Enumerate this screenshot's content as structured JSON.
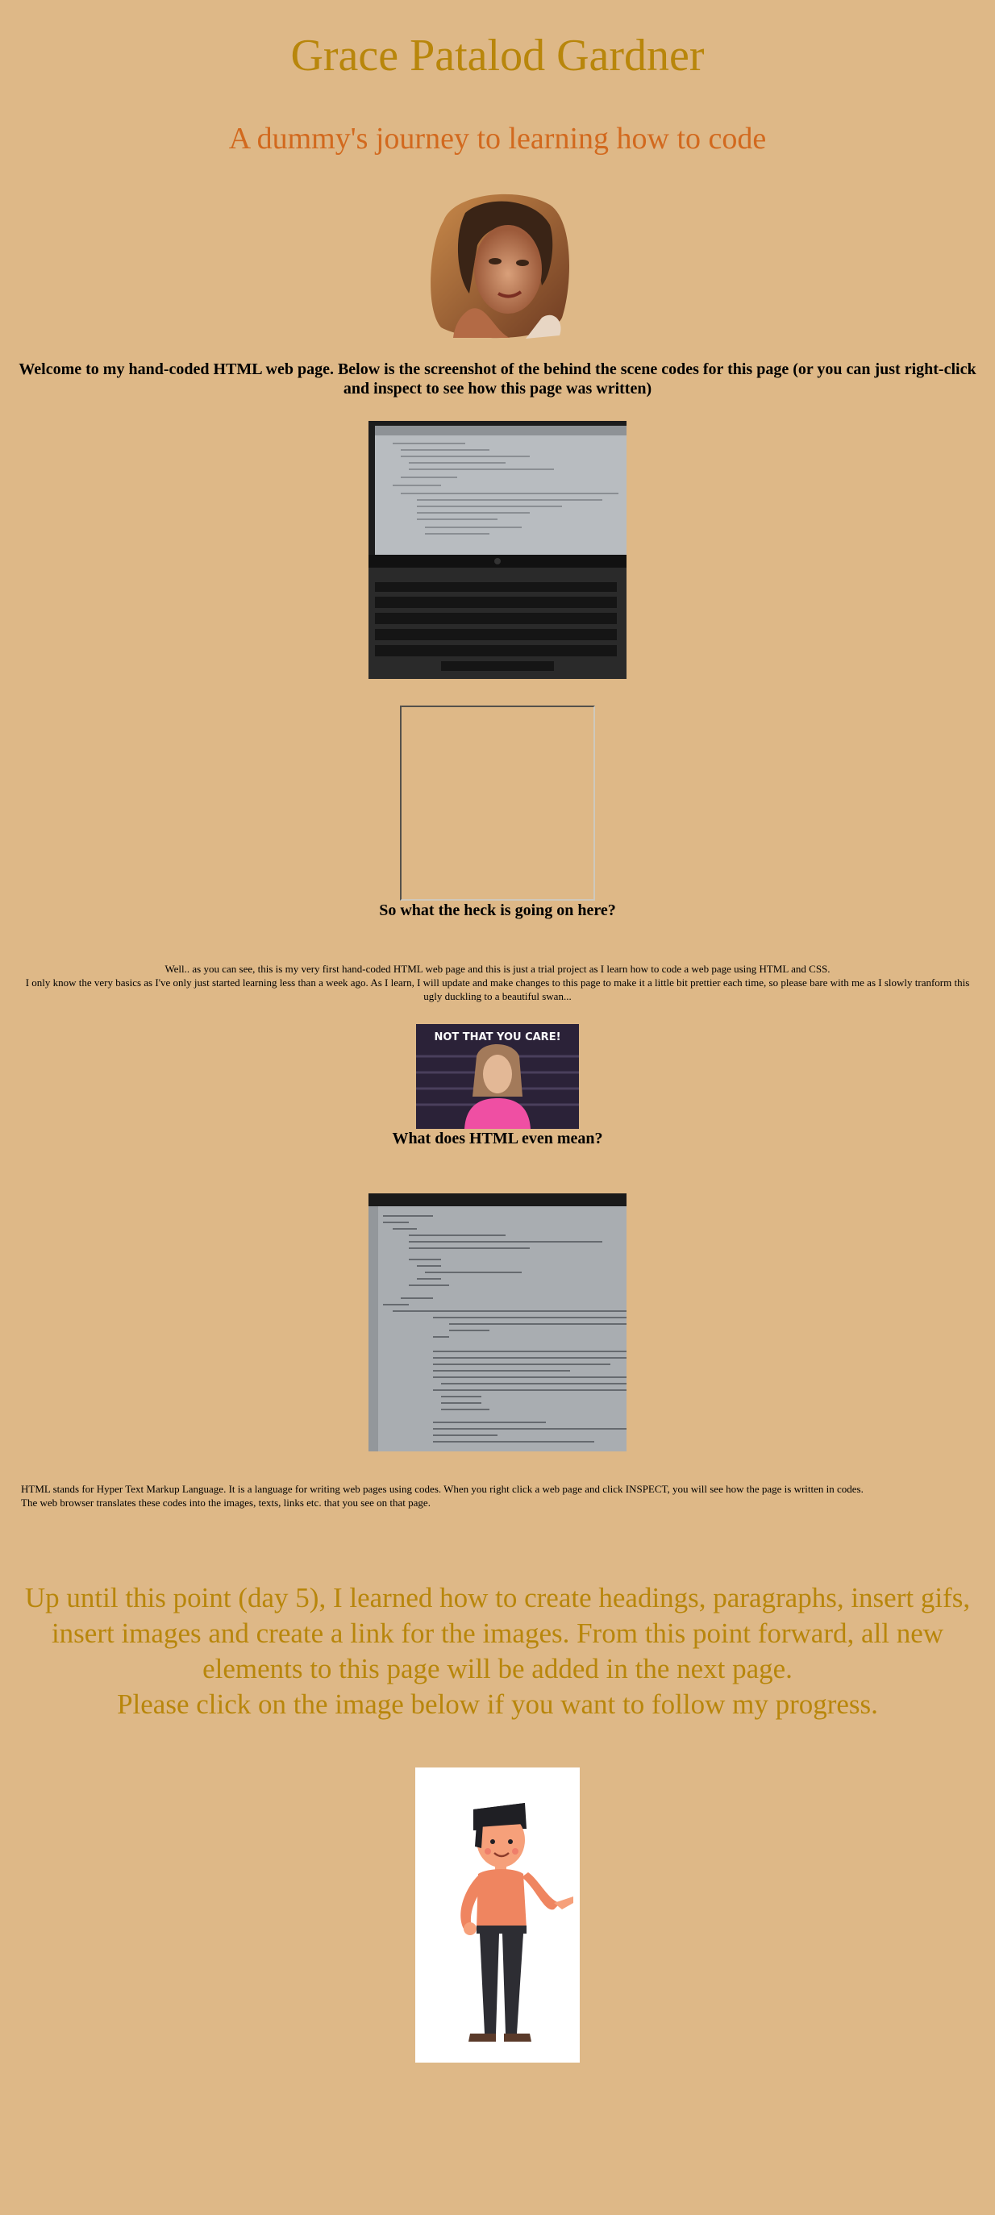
{
  "header": {
    "title": "Grace Patalod Gardner",
    "subtitle": "A dummy's journey to learning how to code"
  },
  "intro": {
    "welcome_text": "Welcome to my hand-coded HTML web page. Below is the screenshot of the behind the scene codes for this page (or you can just right-click and inspect to see how this page was written)"
  },
  "section_1": {
    "heading": "So what the heck is going on here?",
    "para_line_1": "Well.. as you can see, this is my very first hand-coded HTML web page and this is just a trial project as I learn how to code a web page using HTML and CSS.",
    "para_line_2": "I only know the very basics as I've only just started learning less than a week ago. As I learn, I will update and make changes to this page to make it a little bit prettier each time, so please bare with me as I slowly tranform this ugly duckling to a beautiful swan...",
    "gif_caption": "NOT THAT YOU CARE!"
  },
  "section_2": {
    "heading": "What does HTML even mean?",
    "para_line_1": "HTML stands for Hyper Text Markup Language. It is a language for writing web pages using codes. When you right click a web page and click INSPECT, you will see how the page is written in codes.",
    "para_line_2": "The web browser translates these codes into the images, texts, links etc. that you see on that page."
  },
  "progress_note": {
    "line_1": "Up until this point (day 5), I learned how to create headings, paragraphs, insert gifs, insert images and create a link for the images. From this point forward, all new elements to this page will be added in the next page.",
    "line_2": "Please click on the image below if you want to follow my progress."
  },
  "colors": {
    "background": "#deb887",
    "title": "#b8860b",
    "subtitle": "#d2691e",
    "progress_note": "#b8860b"
  }
}
